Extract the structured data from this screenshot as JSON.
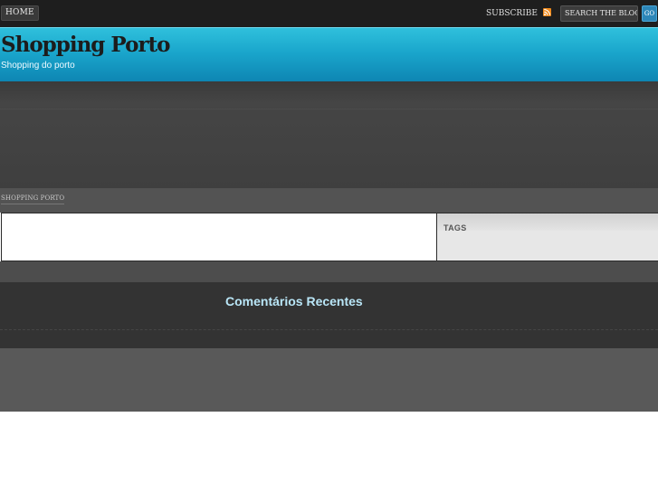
{
  "topbar": {
    "home_label": "HOME",
    "subscribe_label": "SUBSCRIBE",
    "search_placeholder": "SEARCH THE BLOG...",
    "go_label": "GO",
    "rss_icon": "rss-icon",
    "accent_color": "#2c86b8"
  },
  "header": {
    "site_title": "Shopping Porto",
    "tagline": "Shopping do porto",
    "gradient_top": "#2fc0dc",
    "gradient_bottom": "#0e86b3"
  },
  "breadcrumb": {
    "item": "SHOPPING PORTO"
  },
  "sidebar": {
    "tags_title": "TAGS"
  },
  "footer_widgets": {
    "recent_comments_title": "Comentários Recentes",
    "title_color": "#b9e6f7"
  }
}
